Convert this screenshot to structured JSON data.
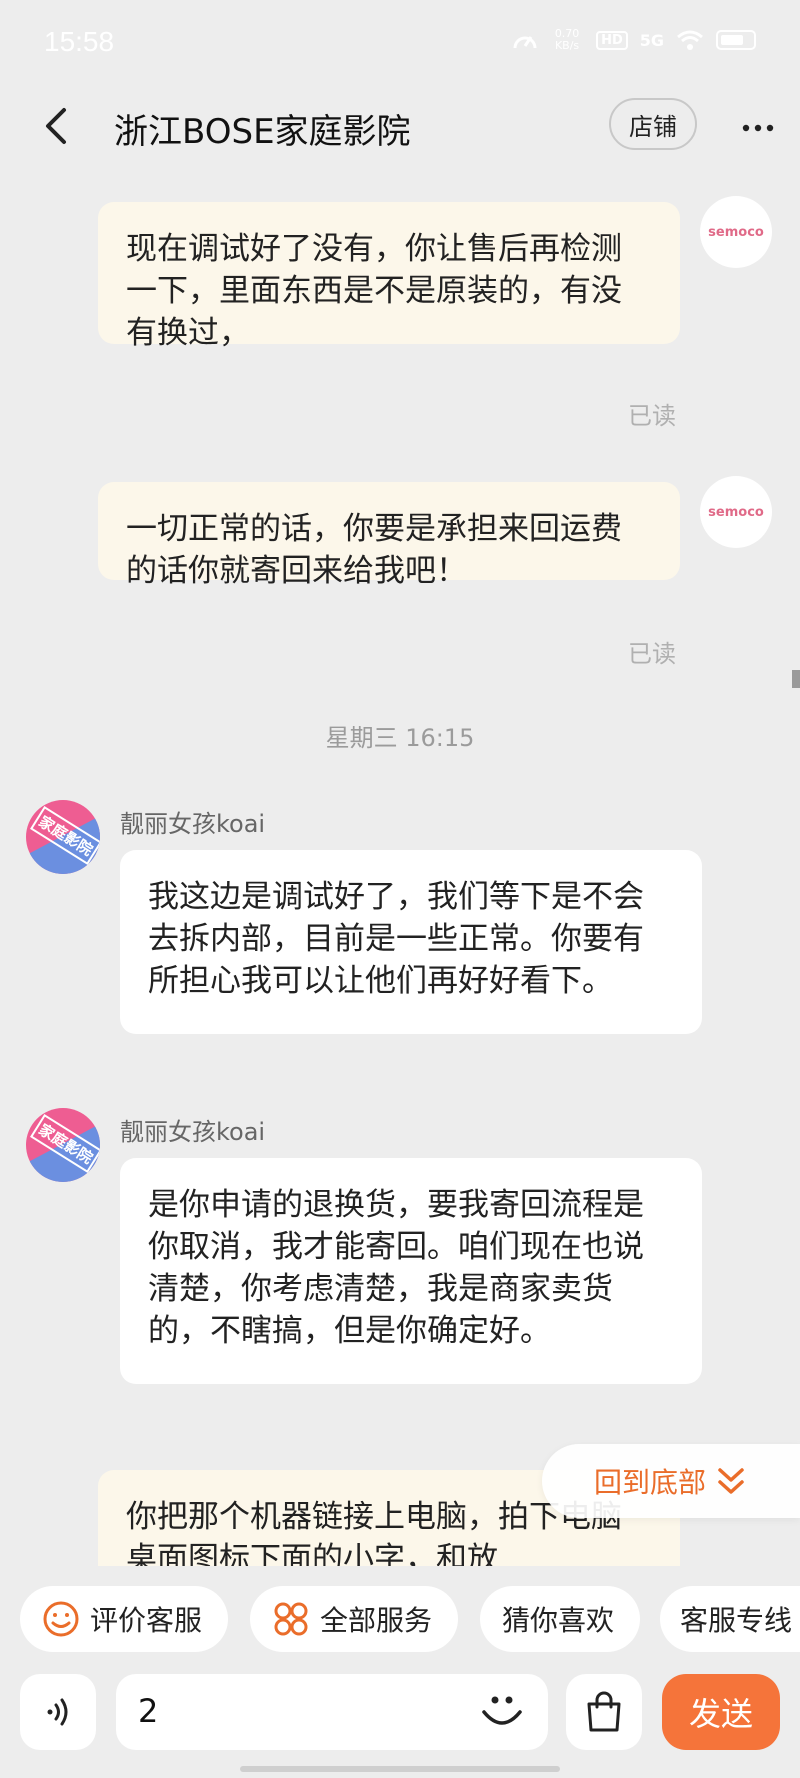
{
  "status_bar": {
    "time": "15:58",
    "net_speed": "0.70\nKB/s",
    "hd_label": "HD",
    "signal_label": "5G"
  },
  "header": {
    "title": "浙江BOSE家庭影院",
    "shop_label": "店铺"
  },
  "messages": [
    {
      "side": "right",
      "avatar_text": "semoco",
      "text": "现在调试好了没有，你让售后再检测一下，里面东西是不是原装的，有没有换过，",
      "read": "已读"
    },
    {
      "side": "right",
      "avatar_text": "semoco",
      "text": "一切正常的话，你要是承担来回运费的话你就寄回来给我吧！",
      "read": "已读"
    },
    {
      "timestamp": "星期三 16:15"
    },
    {
      "side": "left",
      "sender": "靓丽女孩koai",
      "avatar_stamp": "家庭影院",
      "text": "我这边是调试好了，我们等下是不会去拆内部，目前是一些正常。你要有所担心我可以让他们再好好看下。"
    },
    {
      "side": "left",
      "sender": "靓丽女孩koai",
      "avatar_stamp": "家庭影院",
      "text": "是你申请的退换货，要我寄回流程是你取消，我才能寄回。咱们现在也说清楚，你考虑清楚，我是商家卖货的，不瞎搞，但是你确定好。"
    },
    {
      "side": "right",
      "text": "你把那个机器链接上电脑，拍下电脑桌面图标下面的小字，和放"
    }
  ],
  "scroll_to_bottom_label": "回到底部",
  "quick_services": [
    {
      "label": "评价客服",
      "icon": "smiley-icon"
    },
    {
      "label": "全部服务",
      "icon": "grid-icon"
    },
    {
      "label": "猜你喜欢",
      "icon": ""
    },
    {
      "label": "客服专线",
      "icon": ""
    }
  ],
  "input": {
    "value": "2",
    "send_label": "发送"
  },
  "colors": {
    "accent": "#f5743a",
    "my_bubble": "#fcf7ea",
    "their_bubble": "#ffffff",
    "background": "#ededed"
  }
}
